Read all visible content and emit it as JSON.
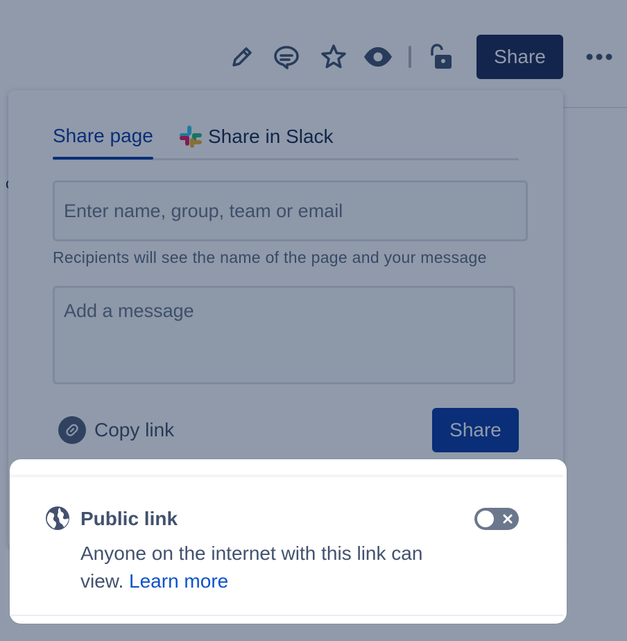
{
  "toolbar": {
    "icons": [
      "edit-icon",
      "comment-icon",
      "star-icon",
      "watch-icon",
      "unlock-icon",
      "more-icon"
    ],
    "share_label": "Share"
  },
  "dialog": {
    "tabs": [
      {
        "label": "Share page",
        "active": true
      },
      {
        "label": "Share in Slack",
        "active": false
      }
    ],
    "recipients_placeholder": "Enter name, group, team or email",
    "helper_text": "Recipients will see the name of the page and your message",
    "message_placeholder": "Add a message",
    "copy_link_label": "Copy link",
    "share_label": "Share"
  },
  "public_link": {
    "title": "Public link",
    "description": "Anyone on the internet with this link can view.",
    "learn_more": "Learn more",
    "enabled": false
  },
  "colors": {
    "primary": "#0c3ba3",
    "navy": "#1d2b56",
    "text": "#42526e",
    "link": "#0c52cc"
  }
}
